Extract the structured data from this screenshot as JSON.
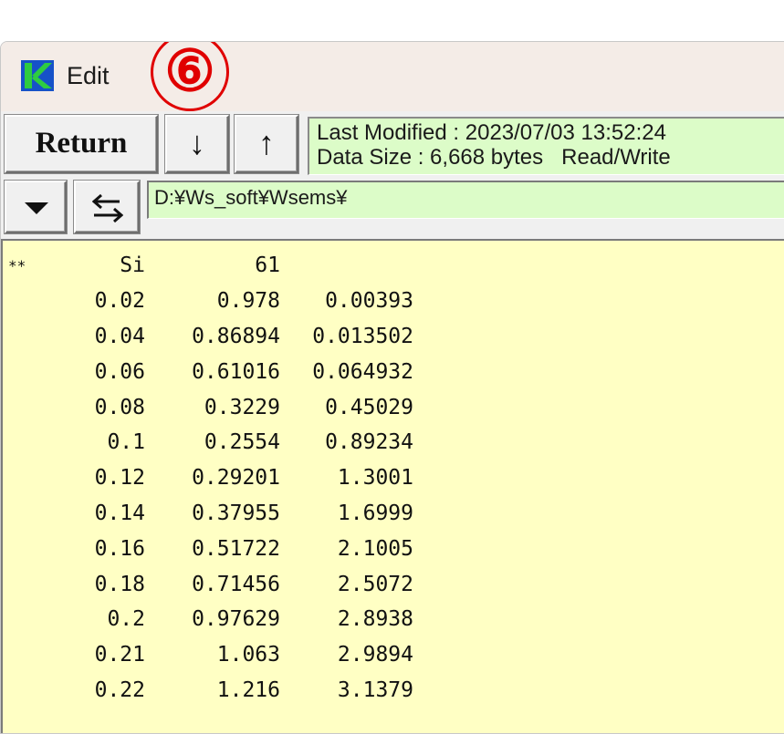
{
  "window": {
    "title": "Edit",
    "step_badge": "⑥"
  },
  "toolbar": {
    "return_label": "Return",
    "down_label": "↓",
    "up_label": "↑"
  },
  "file_info": {
    "last_modified": "Last Modified : 2023/07/03 13:52:24",
    "data_size": "Data Size : 6,668 bytes   Read/Write"
  },
  "path": {
    "value": "D:¥Ws_soft¥Wsems¥"
  },
  "icons": {
    "app": "app-logo-icon",
    "dropdown": "chevron-down-icon",
    "swap": "swap-arrows-icon"
  },
  "colors": {
    "info_bg": "#dcfcc8",
    "editor_bg": "#ffffc4",
    "badge": "#e00000",
    "logo_green": "#2ecc40",
    "logo_blue": "#1652c8"
  },
  "editor": {
    "rows": [
      [
        "**",
        "Si",
        "61",
        ""
      ],
      [
        "",
        "0.02",
        "0.978",
        "0.00393"
      ],
      [
        "",
        "0.04",
        "0.86894",
        "0.013502"
      ],
      [
        "",
        "0.06",
        "0.61016",
        "0.064932"
      ],
      [
        "",
        "0.08",
        "0.3229",
        "0.45029"
      ],
      [
        "",
        "0.1",
        "0.2554",
        "0.89234"
      ],
      [
        "",
        "0.12",
        "0.29201",
        "1.3001"
      ],
      [
        "",
        "0.14",
        "0.37955",
        "1.6999"
      ],
      [
        "",
        "0.16",
        "0.51722",
        "2.1005"
      ],
      [
        "",
        "0.18",
        "0.71456",
        "2.5072"
      ],
      [
        "",
        "0.2",
        "0.97629",
        "2.8938"
      ],
      [
        "",
        "0.21",
        "1.063",
        "2.9894"
      ],
      [
        "",
        "0.22",
        "1.216",
        "3.1379"
      ]
    ]
  }
}
